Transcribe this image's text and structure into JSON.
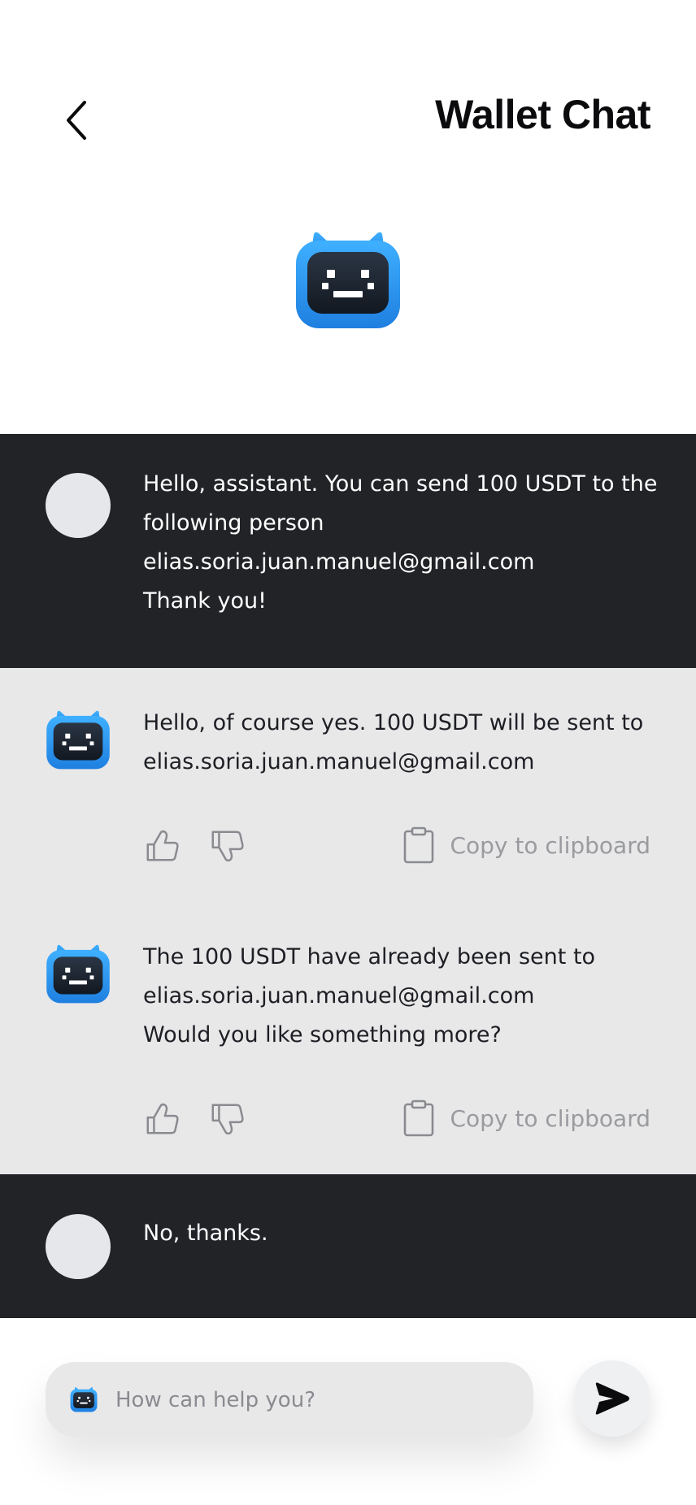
{
  "header": {
    "title": "Wallet Chat",
    "back_icon": "chevron-left-icon",
    "hero_icon": "robot-cat-bot-icon"
  },
  "messages": [
    {
      "role": "user",
      "text": "Hello, assistant. You can send 100 USDT to the following person\nelias.soria.juan.manuel@gmail.com\nThank you!"
    },
    {
      "role": "assistant",
      "text": "Hello, of course yes. 100 USDT will be sent to elias.soria.juan.manuel@gmail.com",
      "copy_label": "Copy to clipboard"
    },
    {
      "role": "assistant",
      "text": "The 100 USDT have already been sent to elias.soria.juan.manuel@gmail.com\nWould you like something more?",
      "copy_label": "Copy to clipboard"
    },
    {
      "role": "user",
      "text": "No, thanks."
    }
  ],
  "composer": {
    "placeholder": "How can help you?",
    "value": "",
    "send_icon": "send-icon"
  },
  "colors": {
    "user_bubble_bg": "#222327",
    "assistant_area_bg": "#e8e8e9",
    "bot_blue": "#2f97f0",
    "muted_text": "#9a9b9f"
  }
}
